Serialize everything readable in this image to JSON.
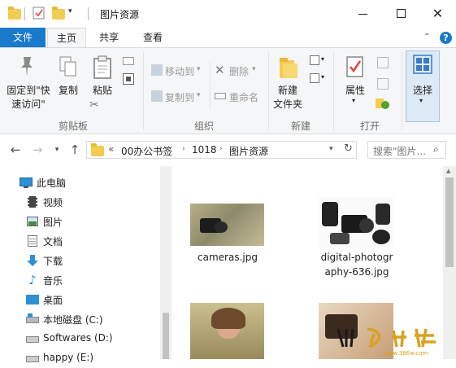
{
  "window": {
    "title": "图片资源"
  },
  "ribbon_tabs": {
    "file": "文件",
    "home": "主页",
    "share": "共享",
    "view": "查看"
  },
  "clipboard": {
    "pin_line1": "固定到\"快",
    "pin_line2": "速访问\"",
    "copy": "复制",
    "paste": "粘贴",
    "group": "剪贴板"
  },
  "organize": {
    "move_to": "移动到",
    "delete": "删除",
    "copy_to": "复制到",
    "rename": "重命名",
    "group": "组织"
  },
  "new": {
    "new_folder_line1": "新建",
    "new_folder_line2": "文件夹",
    "group": "新建"
  },
  "open": {
    "properties": "属性",
    "group": "打开"
  },
  "select": {
    "select": "选择"
  },
  "address": {
    "overflow": "«",
    "crumbs": [
      "00办公书签",
      "1018",
      "图片资源"
    ]
  },
  "search": {
    "placeholder": "搜索\"图片..."
  },
  "nav_pane": {
    "items": [
      "此电脑",
      "视频",
      "图片",
      "文档",
      "下载",
      "音乐",
      "桌面",
      "本地磁盘 (C:)",
      "Softwares (D:)",
      "happy (E:)"
    ]
  },
  "files": [
    {
      "name_line1": "cameras.jpg",
      "name_line2": ""
    },
    {
      "name_line1": "digital-photogr",
      "name_line2": "aphy-636.jpg"
    }
  ],
  "watermark": {
    "text": "系统城",
    "url": "www.386w.com"
  },
  "colors": {
    "accent": "#1979ca",
    "ribbon_bg": "#f5f6f7",
    "folder": "#f3cc52"
  }
}
